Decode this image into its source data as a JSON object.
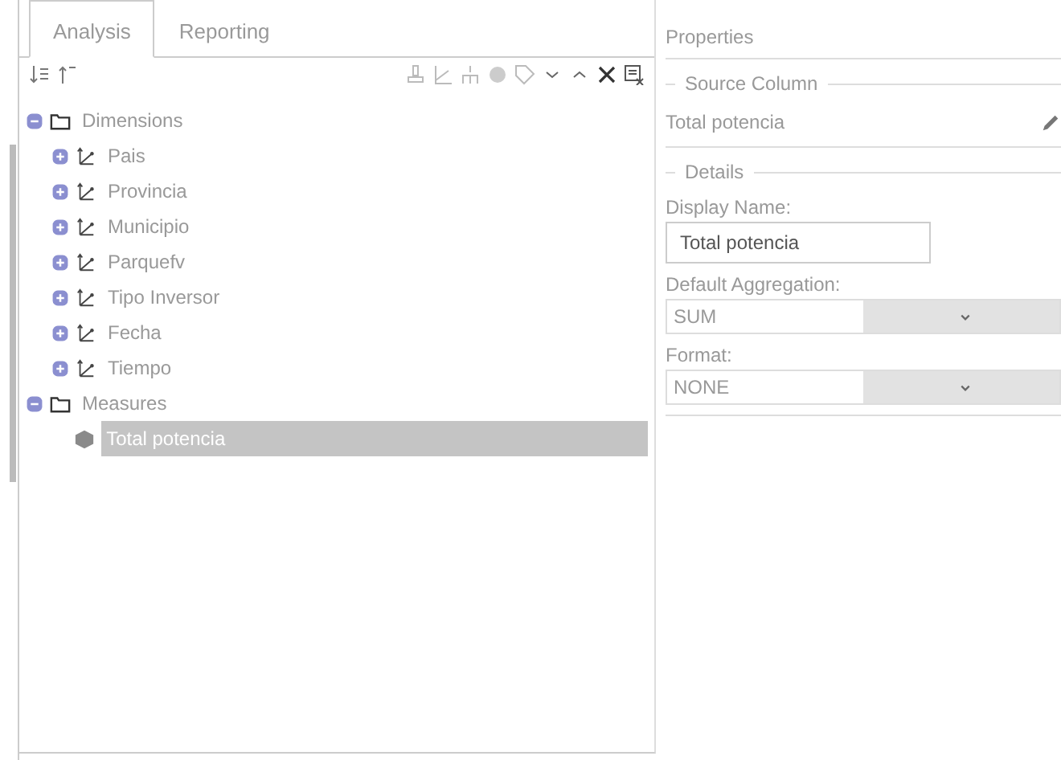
{
  "tabs": [
    {
      "label": "Analysis",
      "selected": true
    },
    {
      "label": "Reporting",
      "selected": false
    }
  ],
  "tree": [
    {
      "label": "Dimensions",
      "kind": "folder",
      "expanded": true,
      "selected": false,
      "children": [
        {
          "label": "Pais",
          "kind": "dimension",
          "expanded": false,
          "selected": false
        },
        {
          "label": "Provincia",
          "kind": "dimension",
          "expanded": false,
          "selected": false
        },
        {
          "label": "Municipio",
          "kind": "dimension",
          "expanded": false,
          "selected": false
        },
        {
          "label": "Parquefv",
          "kind": "dimension",
          "expanded": false,
          "selected": false
        },
        {
          "label": "Tipo Inversor",
          "kind": "dimension",
          "expanded": false,
          "selected": false
        },
        {
          "label": "Fecha",
          "kind": "dimension",
          "expanded": false,
          "selected": false
        },
        {
          "label": "Tiempo",
          "kind": "dimension",
          "expanded": false,
          "selected": false
        }
      ]
    },
    {
      "label": "Measures",
      "kind": "folder",
      "expanded": true,
      "selected": false,
      "children": [
        {
          "label": "Total potencia",
          "kind": "measure",
          "selected": true
        }
      ]
    }
  ],
  "properties": {
    "title": "Properties",
    "source_column": {
      "legend": "Source Column",
      "value": "Total potencia"
    },
    "details": {
      "legend": "Details",
      "display_name_label": "Display Name:",
      "display_name": "Total potencia",
      "aggregation_label": "Default Aggregation:",
      "aggregation": "SUM",
      "format_label": "Format:",
      "format": "NONE"
    }
  }
}
